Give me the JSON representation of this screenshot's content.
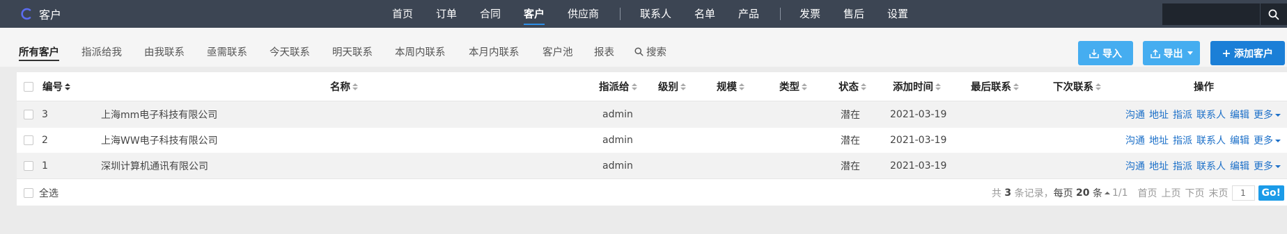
{
  "app": {
    "title": "客户",
    "logo_icon": "c-logo-icon",
    "accent": "#5b6cf0"
  },
  "topnav": {
    "items": [
      "首页",
      "订单",
      "合同",
      "客户",
      "供应商",
      "联系人",
      "名单",
      "产品",
      "发票",
      "售后",
      "设置"
    ],
    "active": "客户",
    "search_placeholder": ""
  },
  "subnav": {
    "tabs": [
      "所有客户",
      "指派给我",
      "由我联系",
      "亟需联系",
      "今天联系",
      "明天联系",
      "本周内联系",
      "本月内联系",
      "客户池",
      "报表"
    ],
    "active": "所有客户",
    "search_label": "搜索"
  },
  "actions": {
    "import": "导入",
    "export": "导出",
    "add": "添加客户"
  },
  "colors": {
    "primary": "#1b7fd7",
    "secondary": "#45adf0",
    "navbar": "#3c4553"
  },
  "table": {
    "headers": {
      "id": "编号",
      "name": "名称",
      "assigned": "指派给",
      "level": "级别",
      "scale": "规模",
      "type": "类型",
      "status": "状态",
      "added": "添加时间",
      "last": "最后联系",
      "next": "下次联系",
      "ops": "操作"
    },
    "rows": [
      {
        "id": "3",
        "name": "上海mm电子科技有限公司",
        "assigned": "admin",
        "status": "潜在",
        "added": "2021-03-19"
      },
      {
        "id": "2",
        "name": "上海WW电子科技有限公司",
        "assigned": "admin",
        "status": "潜在",
        "added": "2021-03-19"
      },
      {
        "id": "1",
        "name": "深圳计算机通讯有限公司",
        "assigned": "admin",
        "status": "潜在",
        "added": "2021-03-19"
      }
    ],
    "row_actions": [
      "沟通",
      "地址",
      "指派",
      "联系人",
      "编辑",
      "更多"
    ]
  },
  "footer": {
    "select_all": "全选",
    "total_prefix": "共",
    "total": "3",
    "total_suffix": "条记录，",
    "per_page_prefix": "每页",
    "per_page": "20",
    "per_page_suffix": "条",
    "pages": "1/1",
    "first": "首页",
    "prev": "上页",
    "next": "下页",
    "last": "末页",
    "page_input": "1",
    "go": "Go!"
  }
}
